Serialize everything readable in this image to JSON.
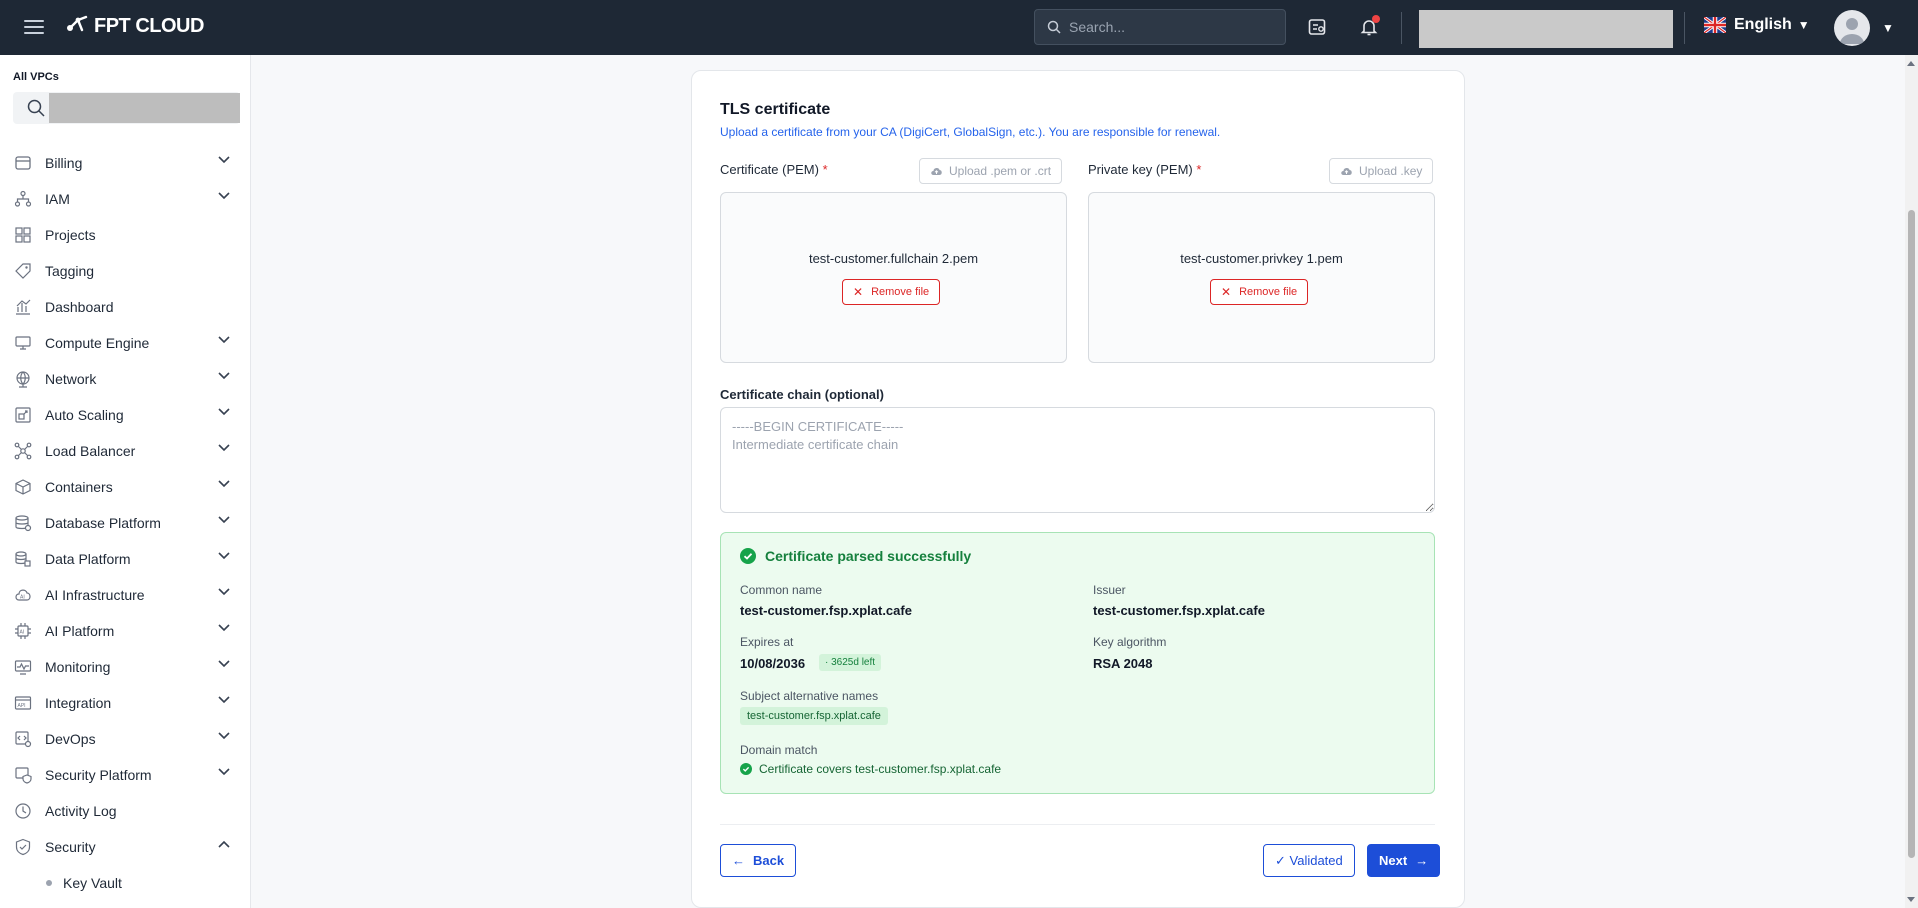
{
  "topbar": {
    "logo_text": "FPT CLOUD",
    "search_placeholder": "Search...",
    "language": "English",
    "icons": [
      "menu-icon",
      "search-icon",
      "task-icon",
      "bell-icon",
      "flag-uk-icon",
      "avatar-icon",
      "caret-down-icon"
    ]
  },
  "sidebar": {
    "vpc_label": "All VPCs",
    "items": [
      {
        "label": "Billing",
        "icon": "billing-icon",
        "expandable": true
      },
      {
        "label": "IAM",
        "icon": "iam-icon",
        "expandable": true
      },
      {
        "label": "Projects",
        "icon": "projects-icon",
        "expandable": false
      },
      {
        "label": "Tagging",
        "icon": "tag-icon",
        "expandable": false
      },
      {
        "label": "Dashboard",
        "icon": "dashboard-icon",
        "expandable": false
      },
      {
        "label": "Compute Engine",
        "icon": "monitor-icon",
        "expandable": true
      },
      {
        "label": "Network",
        "icon": "globe-icon",
        "expandable": true
      },
      {
        "label": "Auto Scaling",
        "icon": "scaling-icon",
        "expandable": true
      },
      {
        "label": "Load Balancer",
        "icon": "load-balancer-icon",
        "expandable": true
      },
      {
        "label": "Containers",
        "icon": "cube-icon",
        "expandable": true
      },
      {
        "label": "Database Platform",
        "icon": "database-icon",
        "expandable": true
      },
      {
        "label": "Data Platform",
        "icon": "data-platform-icon",
        "expandable": true
      },
      {
        "label": "AI Infrastructure",
        "icon": "ai-infra-icon",
        "expandable": true
      },
      {
        "label": "AI Platform",
        "icon": "ai-chip-icon",
        "expandable": true
      },
      {
        "label": "Monitoring",
        "icon": "monitoring-icon",
        "expandable": true
      },
      {
        "label": "Integration",
        "icon": "api-icon",
        "expandable": true
      },
      {
        "label": "DevOps",
        "icon": "devops-icon",
        "expandable": true
      },
      {
        "label": "Security Platform",
        "icon": "security-platform-icon",
        "expandable": true
      },
      {
        "label": "Activity Log",
        "icon": "clock-icon",
        "expandable": false
      },
      {
        "label": "Security",
        "icon": "shield-icon",
        "expandable": true,
        "expanded": true
      }
    ],
    "sub_items": [
      {
        "label": "Key Vault"
      }
    ]
  },
  "card": {
    "title": "TLS certificate",
    "subtitle": "Upload a certificate from your CA (DigiCert, GlobalSign, etc.). You are responsible for renewal.",
    "certificate": {
      "label": "Certificate (PEM)",
      "required_mark": "*",
      "upload_label": "Upload .pem or .crt",
      "file_name": "test-customer.fullchain 2.pem",
      "remove_label": "Remove file"
    },
    "private_key": {
      "label": "Private key (PEM)",
      "required_mark": "*",
      "upload_label": "Upload .key",
      "file_name": "test-customer.privkey 1.pem",
      "remove_label": "Remove file"
    },
    "chain": {
      "label": "Certificate chain (optional)",
      "placeholder": "-----BEGIN CERTIFICATE-----\nIntermediate certificate chain",
      "value": ""
    },
    "result": {
      "heading": "Certificate parsed successfully",
      "common_name_label": "Common name",
      "common_name": "test-customer.fsp.xplat.cafe",
      "issuer_label": "Issuer",
      "issuer": "test-customer.fsp.xplat.cafe",
      "expires_label": "Expires at",
      "expires": "10/08/2036",
      "days_left": "· 3625d left",
      "key_algo_label": "Key algorithm",
      "key_algo": "RSA 2048",
      "san_label": "Subject alternative names",
      "san": "test-customer.fsp.xplat.cafe",
      "domain_match_label": "Domain match",
      "domain_match": "Certificate covers test-customer.fsp.xplat.cafe"
    },
    "actions": {
      "back": "Back",
      "validated": "✓ Validated",
      "next": "Next"
    }
  },
  "colors": {
    "topbar_bg": "#1e2835",
    "accent": "#1d4ed8",
    "success_bg": "#ecfbef",
    "success_text": "#15803d",
    "danger": "#dc2626"
  }
}
